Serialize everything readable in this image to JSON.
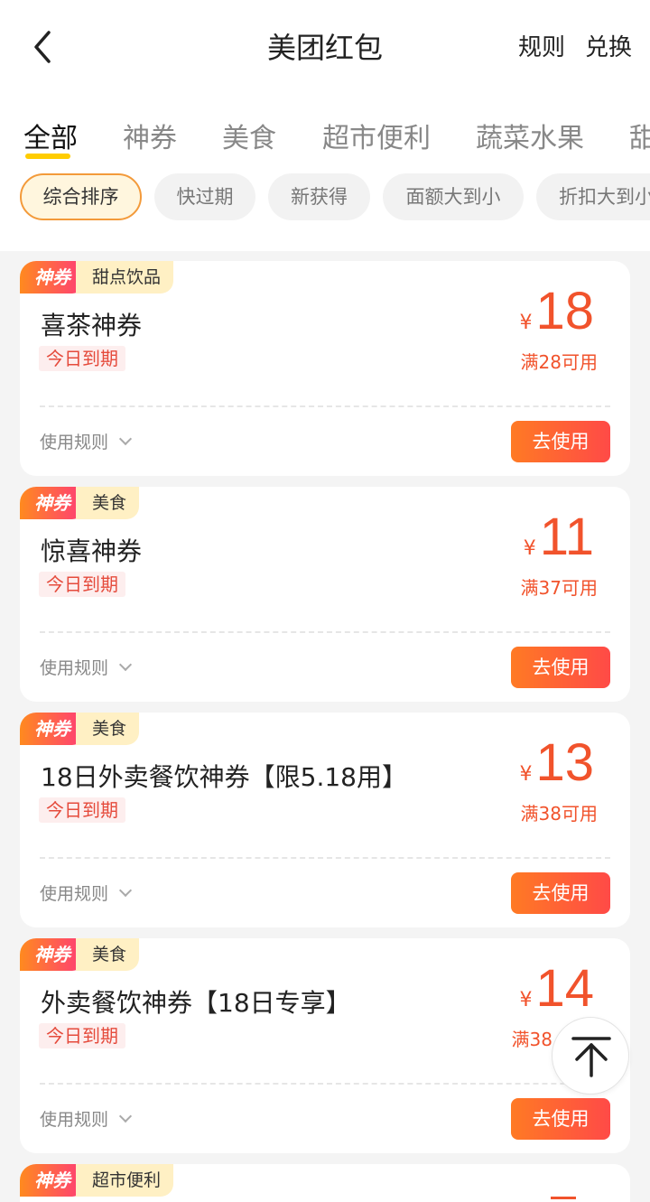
{
  "header": {
    "title": "美团红包",
    "rules_label": "规则",
    "redeem_label": "兑换"
  },
  "tabs": [
    {
      "label": "全部",
      "active": true
    },
    {
      "label": "神券"
    },
    {
      "label": "美食"
    },
    {
      "label": "超市便利"
    },
    {
      "label": "蔬菜水果"
    },
    {
      "label": "甜"
    }
  ],
  "filters": [
    {
      "label": "综合排序",
      "active": true
    },
    {
      "label": "快过期"
    },
    {
      "label": "新获得"
    },
    {
      "label": "面额大到小"
    },
    {
      "label": "折扣大到小"
    }
  ],
  "coupons": [
    {
      "badge": "神券",
      "category": "甜点饮品",
      "title": "喜茶神券",
      "expire": "今日到期",
      "currency": "¥",
      "amount": "18",
      "condition": "满28可用",
      "rules_label": "使用规则",
      "action_label": "去使用"
    },
    {
      "badge": "神券",
      "category": "美食",
      "title": "惊喜神券",
      "expire": "今日到期",
      "currency": "¥",
      "amount": "11",
      "condition": "满37可用",
      "rules_label": "使用规则",
      "action_label": "去使用"
    },
    {
      "badge": "神券",
      "category": "美食",
      "title": "18日外卖餐饮神券【限5.18用】",
      "expire": "今日到期",
      "currency": "¥",
      "amount": "13",
      "condition": "满38可用",
      "rules_label": "使用规则",
      "action_label": "去使用"
    },
    {
      "badge": "神券",
      "category": "美食",
      "title": "外卖餐饮神券【18日专享】",
      "expire": "今日到期",
      "currency": "¥",
      "amount": "14",
      "condition": "满38",
      "rules_label": "使用规则",
      "action_label": "去使用"
    },
    {
      "badge": "神券",
      "category": "超市便利"
    }
  ],
  "colors": {
    "accent": "#f1532c",
    "tab_indicator": "#ffcc00",
    "chip_active_border": "#f39a3a"
  },
  "icons": {
    "back": "chevron-left-icon",
    "scroll_top": "arrow-up-to-top-icon"
  }
}
